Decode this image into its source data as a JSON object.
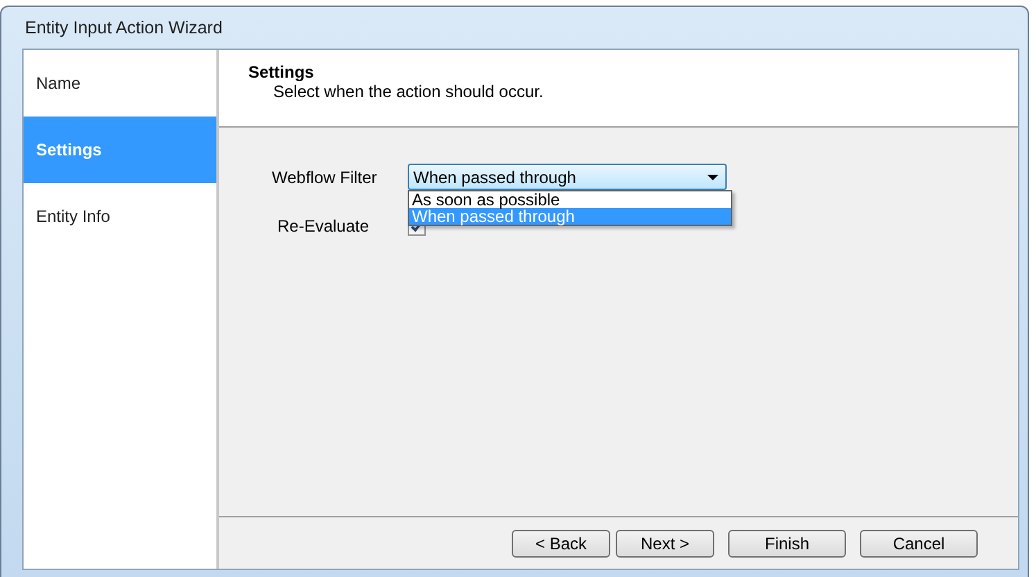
{
  "window": {
    "title": "Entity Input Action Wizard"
  },
  "sidebar": {
    "items": [
      {
        "label": "Name",
        "selected": false
      },
      {
        "label": "Settings",
        "selected": true
      },
      {
        "label": "Entity Info",
        "selected": false
      }
    ]
  },
  "header": {
    "title": "Settings",
    "subtitle": "Select when the action should occur."
  },
  "webflow_filter": {
    "label": "Webflow Filter",
    "value": "When passed through",
    "expanded": true,
    "options": [
      {
        "label": "As soon as possible",
        "selected": false
      },
      {
        "label": "When passed through",
        "selected": true
      }
    ]
  },
  "re_evaluate": {
    "label": "Re-Evaluate",
    "checked": true
  },
  "buttons": [
    "< Back",
    "Next >",
    "Finish",
    "Cancel"
  ]
}
